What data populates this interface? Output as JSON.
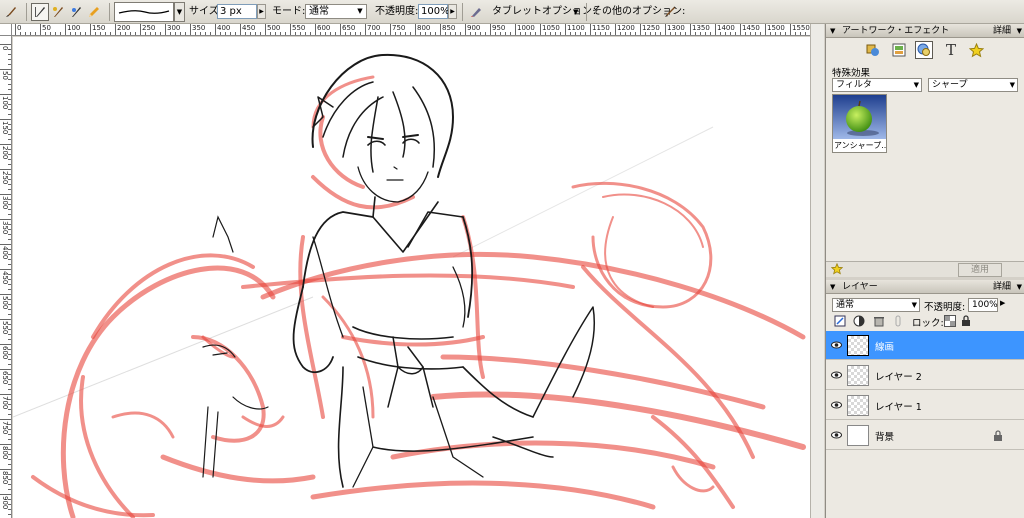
{
  "toolbar": {
    "size_label": "サイズ:",
    "size_value": "3 px",
    "mode_label": "モード:",
    "mode_value": "通常",
    "opacity_label": "不透明度:",
    "opacity_value": "100%",
    "tablet_options_label": "タブレットオプション：",
    "other_options_label": "その他のオプション:"
  },
  "ruler": {
    "top_labels": [
      "0",
      "50",
      "100",
      "150",
      "200",
      "250",
      "300",
      "350",
      "400",
      "450",
      "500",
      "550",
      "600",
      "650",
      "700",
      "750",
      "800",
      "850",
      "900",
      "950",
      "1000",
      "1050",
      "1100",
      "1150",
      "1200",
      "1250",
      "1300",
      "1350",
      "1400",
      "1450",
      "1500",
      "1550"
    ],
    "left_labels": [
      "0",
      "50",
      "100",
      "150",
      "200",
      "250",
      "300",
      "350",
      "400",
      "450",
      "500",
      "550",
      "600",
      "650",
      "700",
      "750",
      "800",
      "850",
      "900"
    ]
  },
  "artwork_panel": {
    "title": "アートワーク・エフェクト",
    "more_label": "詳細",
    "section_label": "特殊効果",
    "category_value": "フィルタ",
    "subcategory_value": "シャープ",
    "thumbnail_caption": "アンシャープ...",
    "apply_label": "適用"
  },
  "layers_panel": {
    "title": "レイヤー",
    "more_label": "詳細",
    "blend_mode": "通常",
    "opacity_label": "不透明度:",
    "opacity_value": "100%",
    "lock_label": "ロック:",
    "layers": [
      {
        "name": "線画",
        "selected": true
      },
      {
        "name": "レイヤー 2",
        "selected": false
      },
      {
        "name": "レイヤー 1",
        "selected": false
      },
      {
        "name": "背景",
        "selected": false,
        "locked": true
      }
    ]
  },
  "colors": {
    "accent_selection": "#3d95ff",
    "sketch_red": "#e8463c",
    "lineart": "#1a1a1a"
  }
}
